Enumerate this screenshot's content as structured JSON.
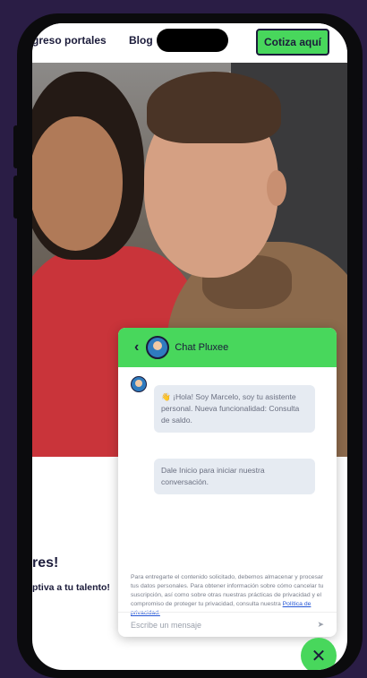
{
  "nav": {
    "item1": "greso portales",
    "item2": "Blog",
    "cta_label": "Cotiza aquí"
  },
  "page": {
    "heading": "res!",
    "sub": "ptiva a tu talento!"
  },
  "chat": {
    "back_icon": "‹",
    "title": "Chat Pluxee",
    "messages": [
      "👋 ¡Hola! Soy Marcelo, soy tu asistente personal. Nueva funcionalidad: Consulta de saldo.",
      "Dale Inicio para iniciar nuestra conversación."
    ],
    "disclaimer_text": "Para entregarte el contenido solicitado, debemos almacenar y procesar tus datos personales. Para obtener información sobre cómo cancelar tu suscripción, así como sobre otras nuestras prácticas de privacidad y el compromiso de proteger tu privacidad, consulta nuestra ",
    "disclaimer_link": "Política de privacidad.",
    "input_placeholder": "Escribe un mensaje",
    "send_icon": "➤",
    "close_icon": "✕"
  },
  "colors": {
    "accent": "#48d75c",
    "navy": "#1b1b3a",
    "background": "#2a1d45"
  }
}
